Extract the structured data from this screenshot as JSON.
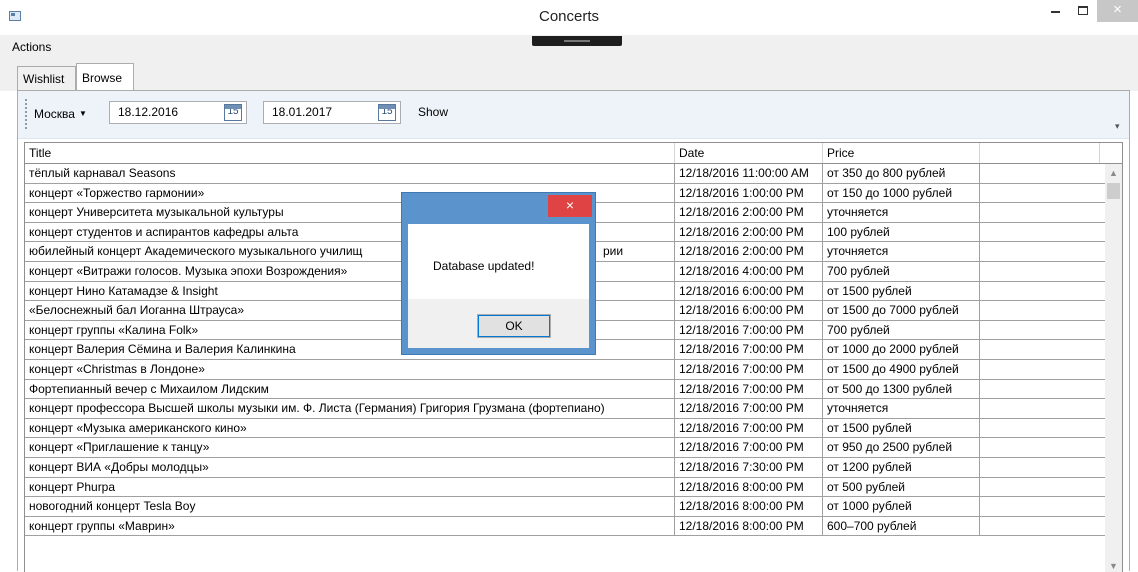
{
  "window": {
    "title": "Concerts",
    "close_glyph": "×"
  },
  "menu": {
    "actions": "Actions"
  },
  "tabs": [
    {
      "label": "Wishlist"
    },
    {
      "label": "Browse"
    }
  ],
  "toolbar": {
    "city": "Москва",
    "date_from": "18.12.2016",
    "date_to": "18.01.2017",
    "calendar_day": "15",
    "show_label": "Show"
  },
  "grid": {
    "columns": [
      "Title",
      "Date",
      "Price"
    ],
    "rows": [
      {
        "title": "тёплый карнавал Seasons",
        "date": "12/18/2016 11:00:00 AM",
        "price": "от 350 до 800 рублей"
      },
      {
        "title": "концерт «Торжество гармонии»",
        "date": "12/18/2016 1:00:00 PM",
        "price": "от 150 до 1000 рублей"
      },
      {
        "title": "концерт Университета музыкальной культуры",
        "date": "12/18/2016 2:00:00 PM",
        "price": "уточняется"
      },
      {
        "title": "концерт студентов и аспирантов кафедры альта",
        "date": "12/18/2016 2:00:00 PM",
        "price": "100 рублей"
      },
      {
        "title": "юбилейный концерт Академического музыкального училищ",
        "title_tail": "рии",
        "date": "12/18/2016 2:00:00 PM",
        "price": "уточняется"
      },
      {
        "title": "концерт «Витражи голосов. Музыка эпохи Возрождения»",
        "date": "12/18/2016 4:00:00 PM",
        "price": "700 рублей"
      },
      {
        "title": "концерт Нино Катамадзе & Insight",
        "date": "12/18/2016 6:00:00 PM",
        "price": "от 1500 рублей"
      },
      {
        "title": "«Белоснежный бал Иоганна Штрауса»",
        "date": "12/18/2016 6:00:00 PM",
        "price": "от 1500 до 7000 рублей"
      },
      {
        "title": "концерт группы «Калина Folk»",
        "date": "12/18/2016 7:00:00 PM",
        "price": "700 рублей"
      },
      {
        "title": "концерт Валерия Сёмина и Валерия Калинкина",
        "date": "12/18/2016 7:00:00 PM",
        "price": "от 1000 до 2000 рублей"
      },
      {
        "title": "концерт «Christmas в Лондоне»",
        "date": "12/18/2016 7:00:00 PM",
        "price": "от 1500 до 4900 рублей"
      },
      {
        "title": "Фортепианный вечер с Михаилом Лидским",
        "date": "12/18/2016 7:00:00 PM",
        "price": "от 500 до 1300 рублей"
      },
      {
        "title": "концерт профессора Высшей школы музыки им. Ф. Листа (Германия) Григория Грузмана (фортепиано)",
        "date": "12/18/2016 7:00:00 PM",
        "price": "уточняется"
      },
      {
        "title": "концерт «Музыка американского кино»",
        "date": "12/18/2016 7:00:00 PM",
        "price": "от 1500 рублей"
      },
      {
        "title": "концерт «Приглашение к танцу»",
        "date": "12/18/2016 7:00:00 PM",
        "price": "от 950 до 2500 рублей"
      },
      {
        "title": "концерт ВИА «Добры молодцы»",
        "date": "12/18/2016 7:30:00 PM",
        "price": "от 1200 рублей"
      },
      {
        "title": "концерт Phurpa",
        "date": "12/18/2016 8:00:00 PM",
        "price": "от 500 рублей"
      },
      {
        "title": "новогодний концерт Tesla Boy",
        "date": "12/18/2016 8:00:00 PM",
        "price": "от 1000 рублей"
      },
      {
        "title": "концерт группы «Маврин»",
        "date": "12/18/2016 8:00:00 PM",
        "price": "600–700 рублей"
      }
    ]
  },
  "dialog": {
    "message": "Database updated!",
    "ok_label": "OK",
    "close_glyph": "×"
  },
  "colors": {
    "dialog_frame": "#5b93cd",
    "dialog_close": "#e04343",
    "toolbar_bg": "#eef3fa"
  },
  "icons": [
    "app-icon",
    "minimize-icon",
    "maximize-icon",
    "close-icon",
    "calendar-icon",
    "dropdown-caret-icon",
    "scroll-up-icon",
    "scroll-down-icon"
  ]
}
